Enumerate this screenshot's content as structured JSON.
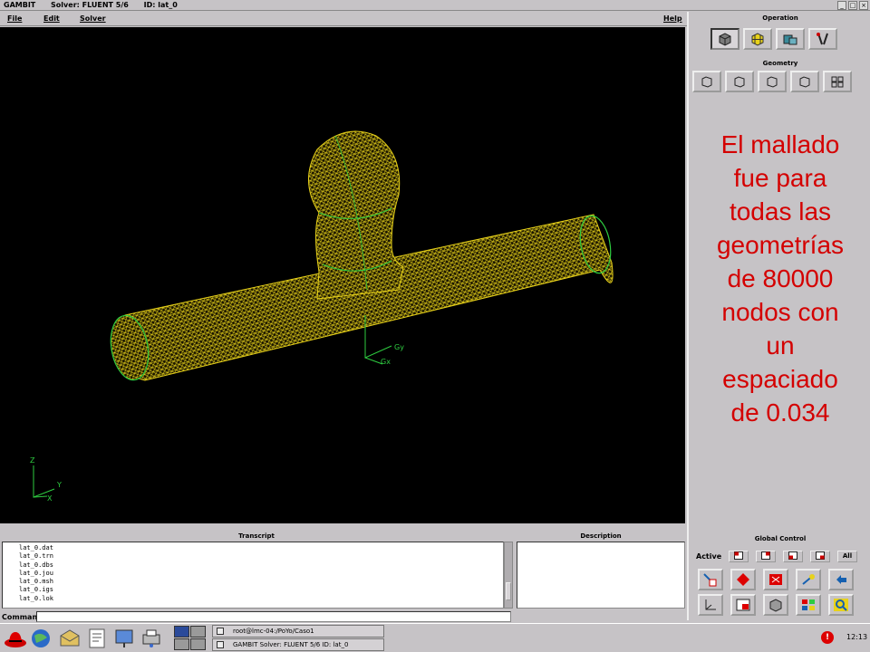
{
  "window": {
    "app_name": "GAMBIT",
    "solver": "Solver: FLUENT 5/6",
    "id": "ID: lat_0"
  },
  "menu": {
    "file": "File",
    "edit": "Edit",
    "solver": "Solver",
    "help": "Help"
  },
  "viewport": {
    "axis_gy": "Gy",
    "axis_gx": "Gx",
    "triad_z": "Z",
    "triad_y": "Y",
    "triad_x": "X",
    "mesh_color": "#e8d21a",
    "edge_color": "#2ecc40"
  },
  "operation": {
    "title": "Operation",
    "buttons": [
      "geometry-icon",
      "mesh-icon",
      "zones-icon",
      "tools-icon"
    ]
  },
  "geometry": {
    "title": "Geometry",
    "buttons": [
      "vertex-icon",
      "edge-icon",
      "face-icon",
      "volume-icon",
      "group-icon"
    ]
  },
  "note": {
    "lines": [
      "El mallado",
      "fue para",
      "todas las",
      "geometrías",
      "de 80000",
      "nodos con",
      "un",
      "espaciado",
      "de 0.034"
    ],
    "color": "#d40000"
  },
  "global_control": {
    "title": "Global Control",
    "active_label": "Active",
    "all_label": "All"
  },
  "transcript": {
    "title": "Transcript",
    "lines": [
      "lat_0.dat",
      "lat_0.trn",
      "lat_0.dbs",
      "lat_0.jou",
      "lat_0.msh",
      "lat_0.igs",
      "lat_0.lok"
    ]
  },
  "description": {
    "title": "Description"
  },
  "command": {
    "label": "Command:",
    "value": ""
  },
  "taskbar": {
    "task1": "root@lmc-04:/PoYo/Caso1",
    "task2": "GAMBIT    Solver: FLUENT 5/6    ID: lat_0",
    "clock": "12:13",
    "alert": "!"
  }
}
